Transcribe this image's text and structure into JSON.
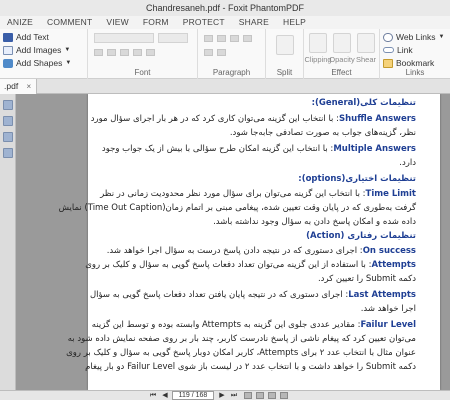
{
  "window": {
    "title": "Chandresaneh.pdf - Foxit PhantomPDF"
  },
  "tabs": [
    "ANIZE",
    "COMMENT",
    "VIEW",
    "FORM",
    "PROTECT",
    "SHARE",
    "HELP"
  ],
  "ribbon": {
    "add_text": "Add Text",
    "add_images": "Add Images",
    "add_shapes": "Add Shapes",
    "clipping": "Clipping",
    "opacity": "Opacity",
    "shear": "Shear",
    "web_links": "Web Links",
    "link": "Link",
    "bookmark": "Bookmark",
    "groups": {
      "font": "Font",
      "paragraph": "Paragraph",
      "split": "Split",
      "effect": "Effect",
      "links": "Links"
    }
  },
  "doc_tab": ".pdf",
  "document": {
    "lines": [
      {
        "parts": [
          {
            "t": "تنظیمات کلی(General):",
            "c": "head"
          }
        ]
      },
      {
        "parts": [
          {
            "t": "Shuffle Answers",
            "c": "k"
          },
          {
            "t": ": با انتخاب این گزینه می‌توان کاری کرد که در هر بار اجرای سؤال مورد",
            "c": ""
          }
        ]
      },
      {
        "parts": [
          {
            "t": "نظر، گزینه‌های جواب به صورت تصادفی جابه‌جا شود.",
            "c": ""
          }
        ]
      },
      {
        "parts": [
          {
            "t": "Multiple Answers",
            "c": "k"
          },
          {
            "t": ": با انتخاب این گزینه امکان طرح سؤالی با بیش از یک جواب وجود",
            "c": ""
          }
        ]
      },
      {
        "parts": [
          {
            "t": "دارد.",
            "c": ""
          }
        ]
      },
      {
        "parts": [
          {
            "t": "تنظیمات اختیاری(options):",
            "c": "head"
          }
        ]
      },
      {
        "parts": [
          {
            "t": "Time Limit",
            "c": "k"
          },
          {
            "t": ": با انتخاب این گزینه می‌توان برای سؤال مورد نظر محدودیت زمانی در نظر",
            "c": ""
          }
        ]
      },
      {
        "parts": [
          {
            "t": "گرفت به‌طوری که در پایان وقت تعیین شده، پیغامی مبنی بر اتمام زمان(Time Out Caption) نمایش",
            "c": ""
          }
        ]
      },
      {
        "parts": [
          {
            "t": "داده شده و امکان پاسخ دادن به سؤال وجود نداشته باشد.",
            "c": ""
          }
        ]
      },
      {
        "parts": [
          {
            "t": "تنظیمات رفتاری (Action)",
            "c": "head"
          }
        ]
      },
      {
        "parts": [
          {
            "t": "On success",
            "c": "k"
          },
          {
            "t": ": اجرای دستوری که در نتیجه دادن پاسخ درست به سؤال اجرا خواهد شد.",
            "c": ""
          }
        ]
      },
      {
        "parts": [
          {
            "t": "Attempts",
            "c": "k"
          },
          {
            "t": ": با استفاده از این گزینه می‌توان تعداد دفعات پاسخ گویی به سؤال و کلیک بر روی",
            "c": ""
          }
        ]
      },
      {
        "parts": [
          {
            "t": "دکمه Submit را تعیین کرد.",
            "c": ""
          }
        ]
      },
      {
        "parts": [
          {
            "t": "Last Attempts",
            "c": "k"
          },
          {
            "t": ": اجرای دستوری که در نتیجه پایان یافتن تعداد دفعات پاسخ گویی به سؤال",
            "c": ""
          }
        ]
      },
      {
        "parts": [
          {
            "t": "اجرا خواهد شد.",
            "c": ""
          }
        ]
      },
      {
        "parts": [
          {
            "t": "Failur Level",
            "c": "k"
          },
          {
            "t": ": مقادیر عددی جلوی این گزینه به Attempts وابسته بوده و توسط این گزینه",
            "c": ""
          }
        ]
      },
      {
        "parts": [
          {
            "t": "می‌توان تعیین کرد که پیغام ناشی از پاسخ نادرست کاربر، چند بار بر روی صفحه نمایش داده شود به",
            "c": ""
          }
        ]
      },
      {
        "parts": [
          {
            "t": "عنوان مثال با انتخاب عدد ۲ برای Attempts، کاربر امکان دوبار پاسخ گویی به سؤال و کلیک بر روی",
            "c": ""
          }
        ]
      },
      {
        "parts": [
          {
            "t": "دکمه Submit را خواهد داشت و با انتخاب عدد ۲ در لیست باز شوی Failur Level دو بار پیغام",
            "c": ""
          }
        ]
      }
    ]
  },
  "status": {
    "page_indicator": "119 / 168"
  }
}
